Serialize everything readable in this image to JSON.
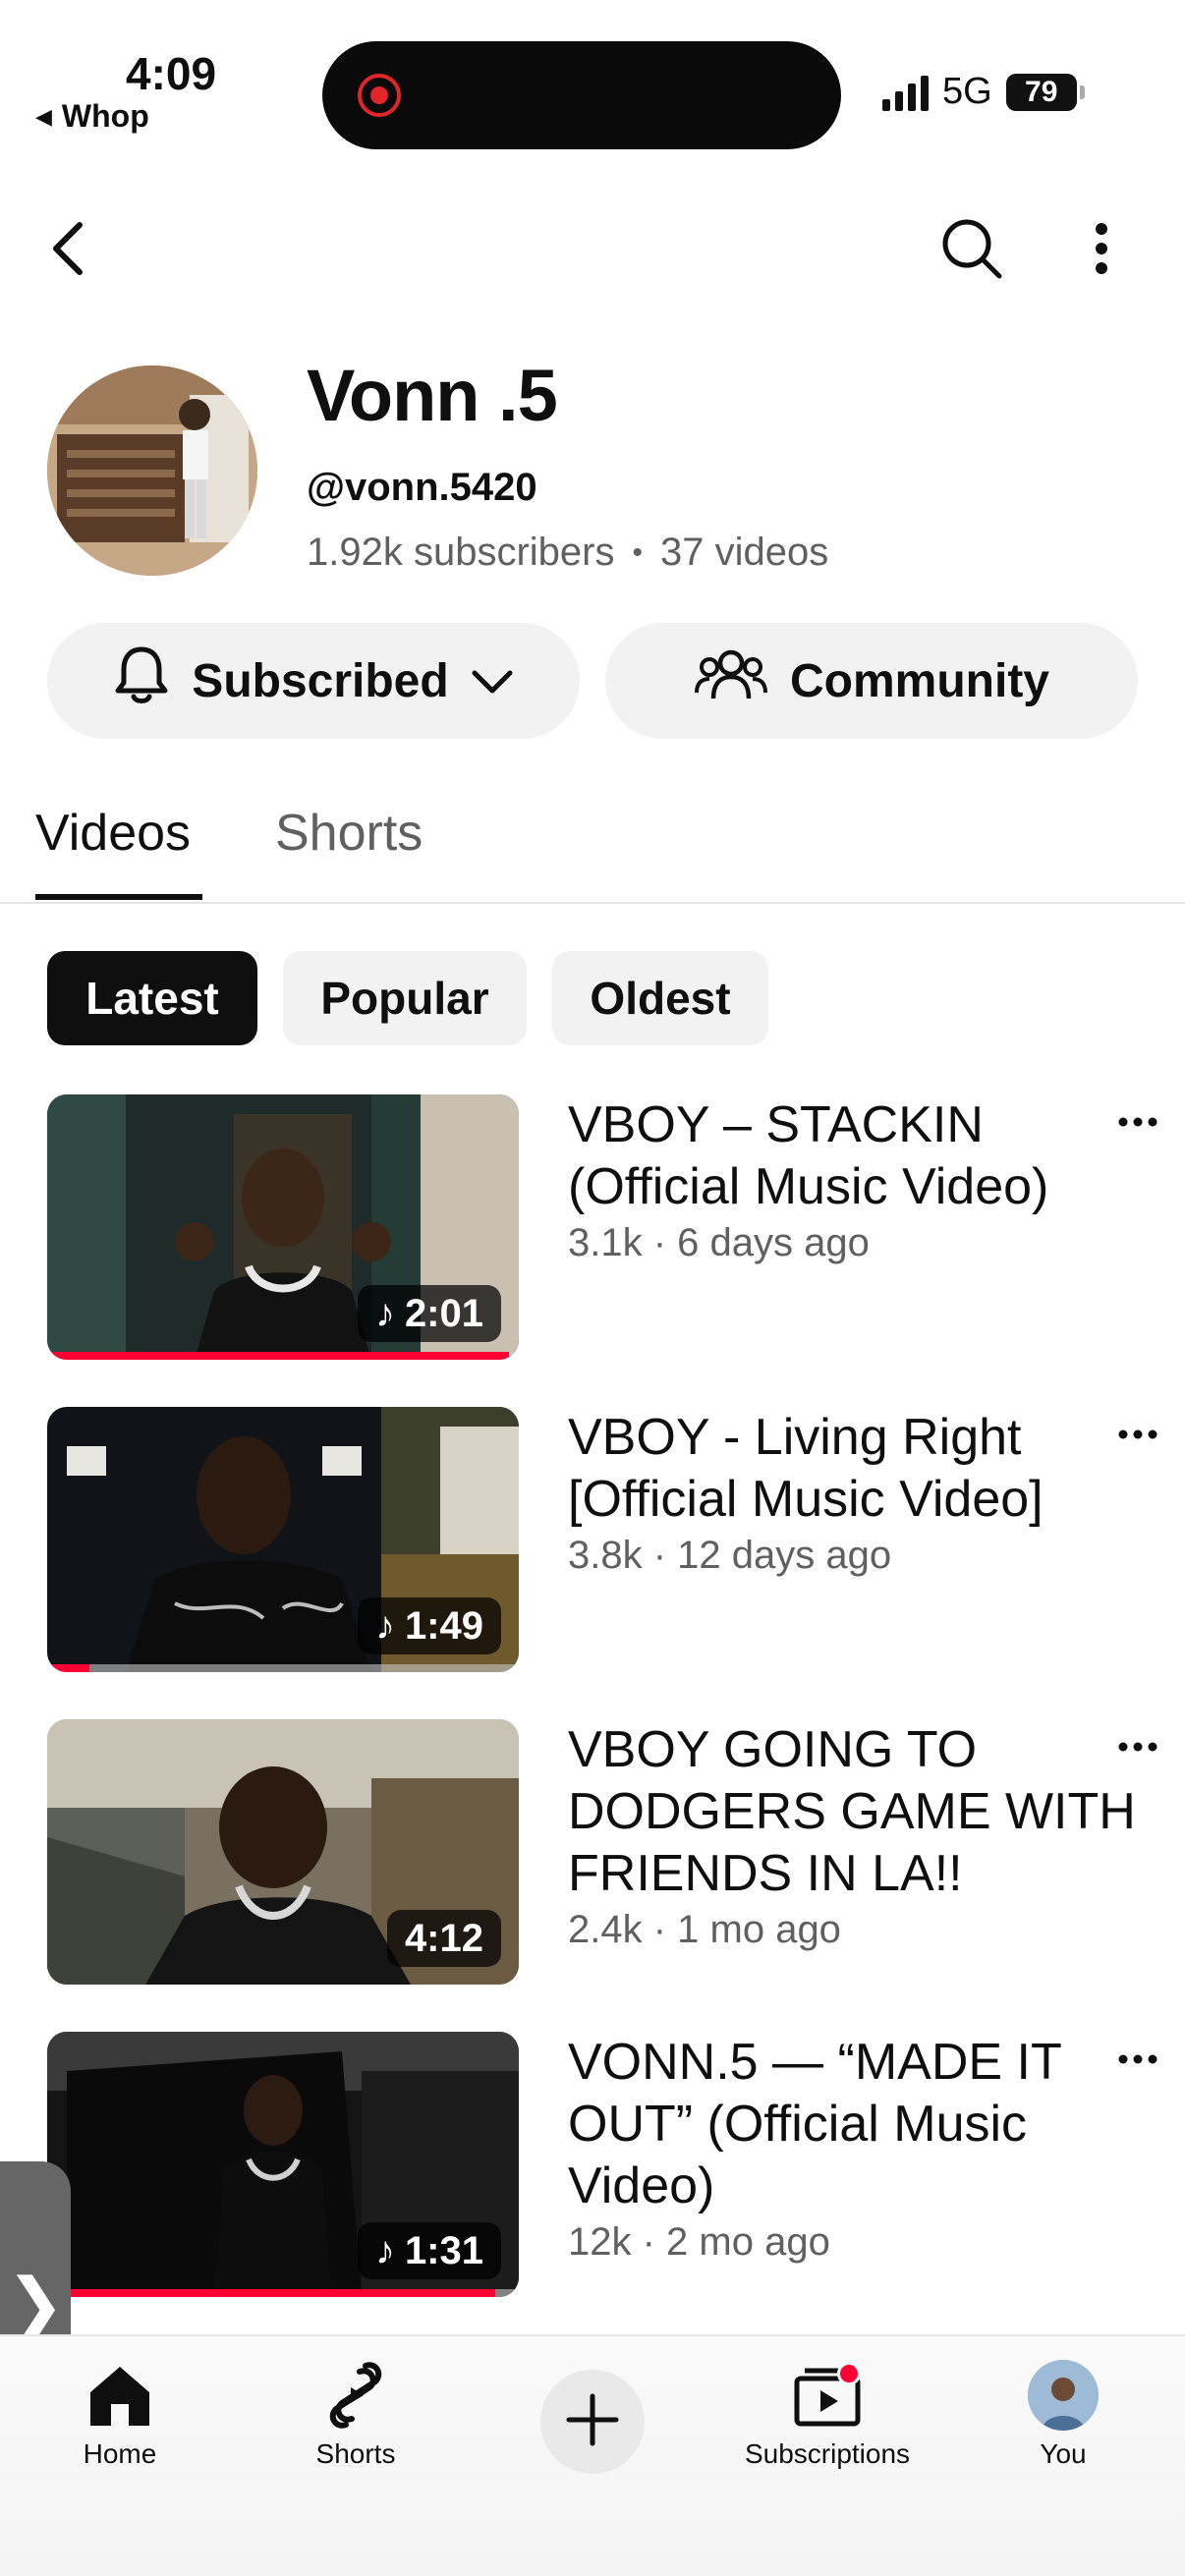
{
  "status_bar": {
    "time": "4:09",
    "back_app": "Whop",
    "network": "5G",
    "battery": "79"
  },
  "channel": {
    "name": "Vonn .5",
    "handle": "@vonn.5420",
    "subscribers": "1.92k subscribers",
    "video_count": "37 videos",
    "subscribe_label": "Subscribed",
    "community_label": "Community"
  },
  "tabs": [
    {
      "label": "Videos",
      "active": true
    },
    {
      "label": "Shorts",
      "active": false
    }
  ],
  "chips": [
    {
      "label": "Latest",
      "active": true
    },
    {
      "label": "Popular",
      "active": false
    },
    {
      "label": "Oldest",
      "active": false
    }
  ],
  "videos": [
    {
      "title": "VBOY – STACKIN (Official Music Video)",
      "meta": "3.1k · 6 days ago",
      "duration": "2:01",
      "music": true,
      "watched": 0.98
    },
    {
      "title": "VBOY - Living Right [Official Music Video]",
      "meta": "3.8k · 12 days ago",
      "duration": "1:49",
      "music": true,
      "watched": 0.09
    },
    {
      "title": "VBOY GOING TO DODGERS GAME WITH FRIENDS IN LA!!",
      "meta": "2.4k · 1 mo ago",
      "duration": "4:12",
      "music": false,
      "watched": 0
    },
    {
      "title": "VONN.5 — “MADE IT OUT” (Official Music Video)",
      "meta": "12k · 2 mo ago",
      "duration": "1:31",
      "music": true,
      "watched": 0.95
    }
  ],
  "bottom_nav": [
    {
      "label": "Home",
      "icon": "home-icon"
    },
    {
      "label": "Shorts",
      "icon": "shorts-icon"
    },
    {
      "label": "",
      "icon": "create-icon"
    },
    {
      "label": "Subscriptions",
      "icon": "subscriptions-icon"
    },
    {
      "label": "You",
      "icon": "avatar"
    }
  ],
  "colors": {
    "accent": "#ff0033",
    "text_primary": "#0f0f0f",
    "text_secondary": "#606060",
    "chip_bg": "#f2f2f2"
  }
}
